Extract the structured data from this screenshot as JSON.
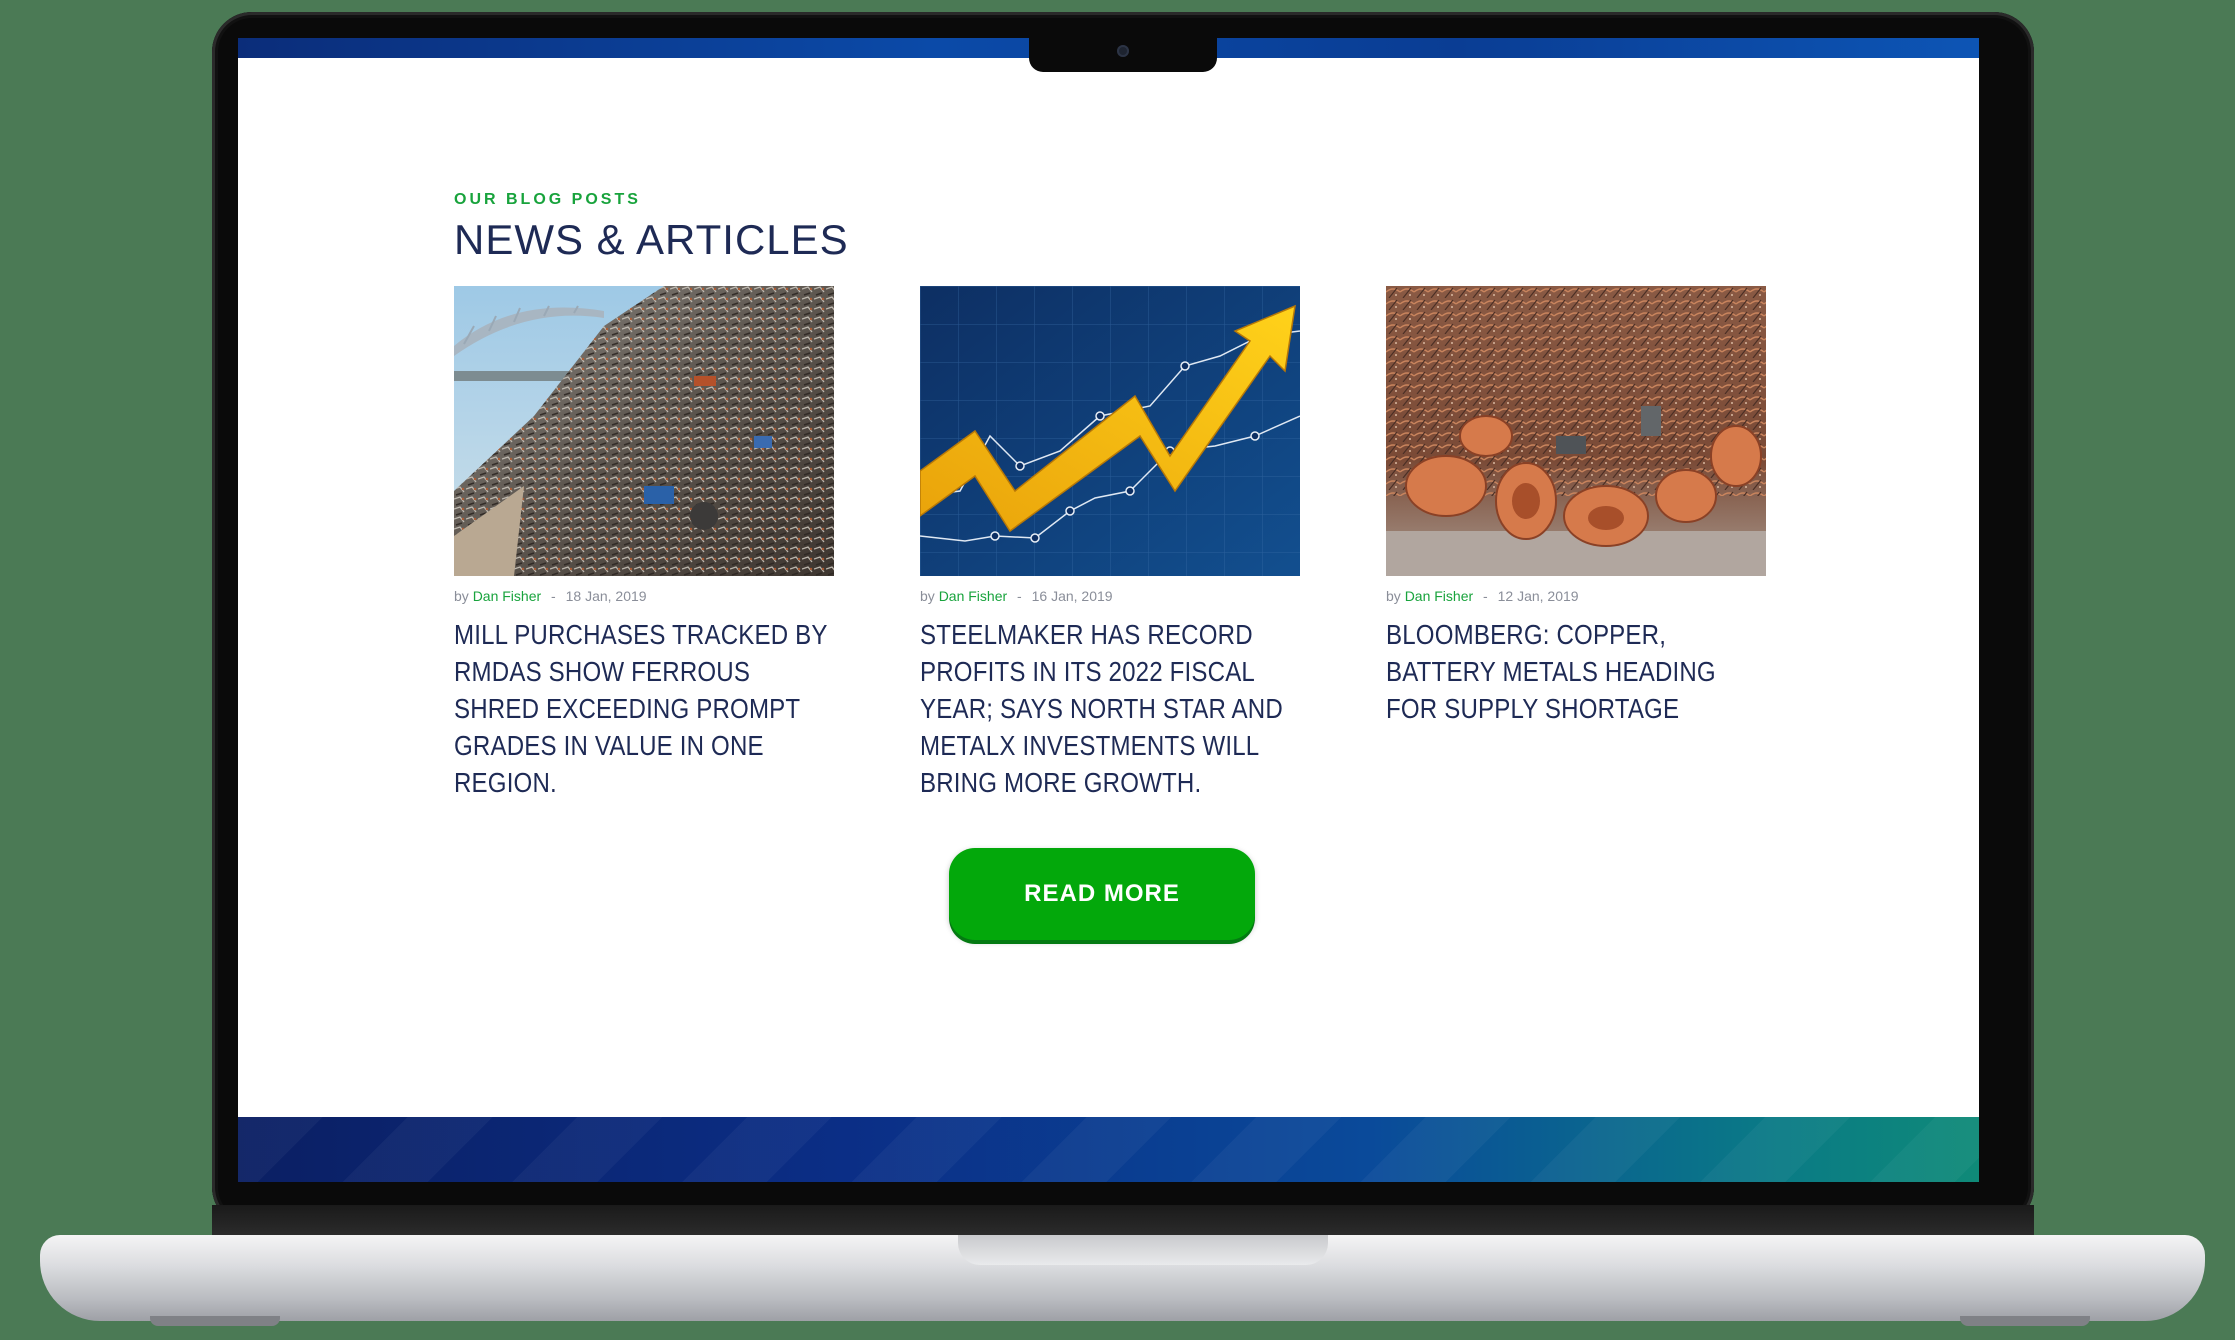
{
  "section": {
    "eyebrow": "OUR BLOG POSTS",
    "title": "NEWS & ARTICLES"
  },
  "posts": [
    {
      "by": "by",
      "author": "Dan Fisher",
      "separator": "-",
      "date": "18 Jan, 2019",
      "title": "MILL PURCHASES TRACKED BY RMDAS SHOW FERROUS SHRED EXCEEDING PROMPT GRADES IN VALUE IN ONE REGION.",
      "image": "scrap-metal-pile-photo"
    },
    {
      "by": "by",
      "author": "Dan Fisher",
      "separator": "-",
      "date": "16 Jan, 2019",
      "title": "STEELMAKER HAS RECORD PROFITS IN ITS 2022 FISCAL YEAR; SAYS NORTH STAR AND METALX INVESTMENTS WILL BRING MORE GROWTH.",
      "image": "rising-chart-arrow-image"
    },
    {
      "by": "by",
      "author": "Dan Fisher",
      "separator": "-",
      "date": "12 Jan, 2019",
      "title": "BLOOMBERG: COPPER, BATTERY METALS HEADING FOR SUPPLY SHORTAGE",
      "image": "copper-scrap-pile-photo"
    }
  ],
  "cta": {
    "label": "READ MORE"
  },
  "colors": {
    "accent_green": "#18a33c",
    "button_green": "#03a80b",
    "heading_navy": "#1e2a55",
    "band_blue": "#0b2e86"
  }
}
